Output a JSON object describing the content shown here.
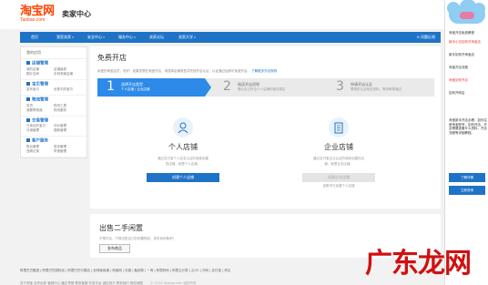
{
  "header": {
    "logo_text": "淘宝网",
    "logo_sub": "Taobao.com",
    "title": "卖家中心"
  },
  "nav": {
    "items": [
      "首页",
      "我是卖家",
      "安全中心",
      "服务中心",
      "卖家论坛",
      "卖家大学"
    ],
    "help": "问题反馈"
  },
  "sidebar": {
    "title": "我的应用",
    "groups": [
      {
        "title": "店铺管理",
        "links": [
          "我的店铺",
          "店铺装修",
          "图片空间",
          "手机淘宝店铺"
        ]
      },
      {
        "title": "宝贝管理",
        "links": [
          "发布宝贝",
          "出售中的宝贝"
        ]
      },
      {
        "title": "物流管理",
        "links": [
          "发货",
          "物流工具",
          "我要寄快递",
          "物流服务"
        ]
      },
      {
        "title": "交易管理",
        "links": [
          "已卖出的宝贝",
          "评价管理",
          "分销管理",
          "退款管理"
        ]
      },
      {
        "title": "客户服务",
        "links": [
          "售后管理",
          "投诉管理",
          "违规记录",
          "举报管理"
        ]
      }
    ]
  },
  "main": {
    "title": "免费开店",
    "desc": "亲爱的淘宝会员，您好！如果您想在淘宝开店，请选择店铺类型并完成开店认证，认证通过后即可免费开店。",
    "desc_link": "了解更多开店规则",
    "steps": [
      {
        "num": "1",
        "t1": "选择开店类型",
        "t2": "个人店铺 / 企业店铺"
      },
      {
        "num": "2",
        "t1": "阅读开店须知",
        "t2": "确认自己符合个人店铺的相关规定"
      },
      {
        "num": "3",
        "t1": "申请开店认证",
        "t2": "需提供认证相关资料，等待审核通过"
      }
    ],
    "personal": {
      "name": "个人店铺",
      "desc1": "通过支付宝个人实名认证的商家创建",
      "desc2": "的店铺，就是个人店铺。",
      "button": "创建个人店铺"
    },
    "enterprise": {
      "name": "企业店铺",
      "desc1": "通过支付宝企业认证的商家创建的店",
      "desc2": "铺，就是企业店铺。",
      "button": "创建企业店铺",
      "note": "该账号已创建个人店铺"
    }
  },
  "used": {
    "title": "出售二手闲置",
    "desc": "不想开店，只想出售自己的闲置物品，发布到闲鱼吧！",
    "button": "发布商品"
  },
  "footer": {
    "links": "阿里巴巴集团 | 阿里巴巴国际站 | 阿里巴巴中国站 | 全球速卖通 | 淘宝网 | 天猫 | 聚划算 | 一淘 | 阿里妈妈 | 阿里云计算 | 云OS | 万网 | 支付宝 | 来往",
    "links2": "关于淘宝  合作伙伴  营销中心  廉正举报  联系客服  开放平台  诚征英才  联系我们  网站地图",
    "copyright": "© 2014 Taobao.com 版权所有"
  },
  "ad": {
    "lines": [
      "淘宝开店免费教程",
      "新手小白如何开淘宝店",
      "新手如何开淘宝店",
      "淘宝开店流程",
      "淘宝如何开店",
      "如何开网店"
    ],
    "body": "淘宝新手开店必看：如何注册淘宝账号，如何开店，开店需要准备什么资料，开店流程等详细教程。",
    "bar1": "了解详情",
    "bar2": "立即咨询"
  },
  "watermark": "广东龙网",
  "colors": {
    "nav": "#1f73c7",
    "step_active": "#2d8ae8",
    "logo": "#ff4400",
    "watermark": "#d01010"
  }
}
